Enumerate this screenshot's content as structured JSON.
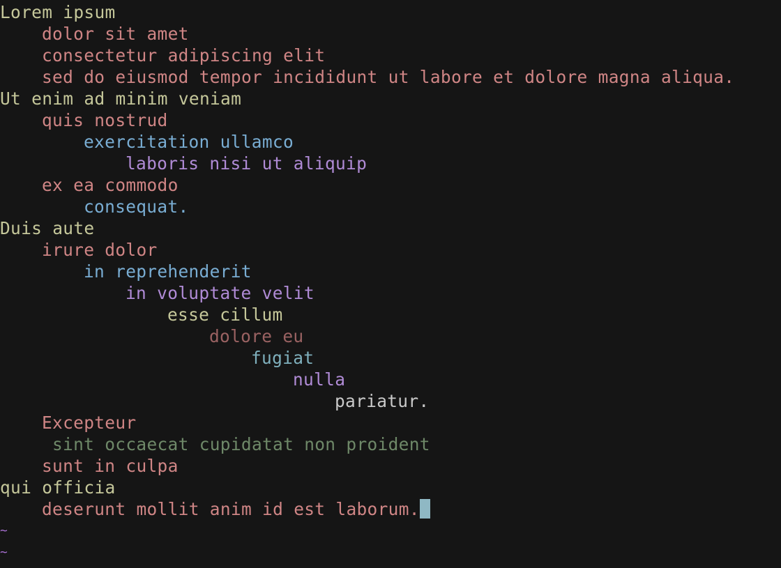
{
  "colors": {
    "background": "#151515",
    "level0": "#c5c79a",
    "level1": "#cf8585",
    "level2": "#79add3",
    "level3": "#b08bd6",
    "level4": "#c5c79a",
    "level5": "#9a6262",
    "level6": "#7fb0bd",
    "level7": "#b08bd6",
    "level8": "#c9c9c9",
    "comment": "#6e8868",
    "cursor": "#8fb8c4",
    "tilde": "#a66fd0"
  },
  "lines": [
    {
      "text": "Lorem ipsum",
      "indent": 0,
      "level": 0
    },
    {
      "text": "dolor sit amet",
      "indent": 4,
      "level": 1
    },
    {
      "text": "consectetur adipiscing elit",
      "indent": 4,
      "level": 1
    },
    {
      "text": "sed do eiusmod tempor incididunt ut labore et dolore magna aliqua.",
      "indent": 4,
      "level": 1
    },
    {
      "text": "Ut enim ad minim veniam",
      "indent": 0,
      "level": 0
    },
    {
      "text": "quis nostrud",
      "indent": 4,
      "level": 1
    },
    {
      "text": "exercitation ullamco",
      "indent": 8,
      "level": 2
    },
    {
      "text": "laboris nisi ut aliquip",
      "indent": 12,
      "level": 3
    },
    {
      "text": "ex ea commodo",
      "indent": 4,
      "level": 1
    },
    {
      "text": "consequat.",
      "indent": 8,
      "level": 2
    },
    {
      "text": "Duis aute",
      "indent": 0,
      "level": 0
    },
    {
      "text": "irure dolor",
      "indent": 4,
      "level": 1
    },
    {
      "text": "in reprehenderit",
      "indent": 8,
      "level": 2
    },
    {
      "text": "in voluptate velit",
      "indent": 12,
      "level": 3
    },
    {
      "text": "esse cillum",
      "indent": 16,
      "level": 4
    },
    {
      "text": "dolore eu",
      "indent": 20,
      "level": 5
    },
    {
      "text": "fugiat",
      "indent": 24,
      "level": 6
    },
    {
      "text": "nulla",
      "indent": 28,
      "level": 7
    },
    {
      "text": "pariatur.",
      "indent": 32,
      "level": 8
    },
    {
      "text": "Excepteur",
      "indent": 4,
      "level": 1
    },
    {
      "text": "sint occaecat cupidatat non proident",
      "indent": 5,
      "level": "comment"
    },
    {
      "text": "sunt in culpa",
      "indent": 4,
      "level": 1
    },
    {
      "text": "qui officia",
      "indent": 0,
      "level": 0
    },
    {
      "text": "deserunt mollit anim id est laborum.",
      "indent": 4,
      "level": 1,
      "cursor": true
    }
  ],
  "empty_lines": [
    "~",
    "~"
  ]
}
